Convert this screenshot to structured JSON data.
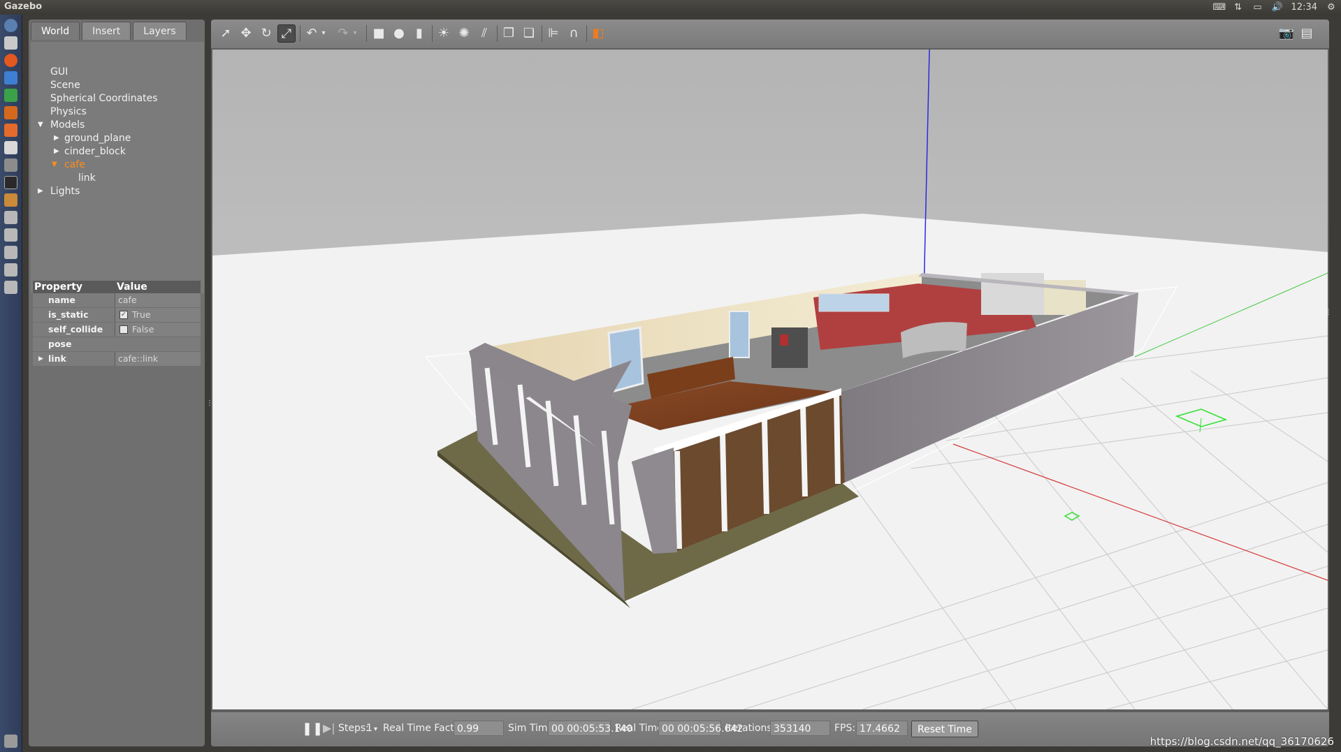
{
  "window": {
    "title": "Gazebo"
  },
  "tray": {
    "time": "12:34"
  },
  "left_panel": {
    "tabs": [
      {
        "label": "World",
        "active": true
      },
      {
        "label": "Insert"
      },
      {
        "label": "Layers"
      }
    ],
    "tree": {
      "gui": "GUI",
      "scene": "Scene",
      "spherical": "Spherical Coordinates",
      "physics": "Physics",
      "models": "Models",
      "ground_plane": "ground_plane",
      "cinder_block": "cinder_block",
      "cafe": "cafe",
      "link": "link",
      "lights": "Lights"
    },
    "properties": {
      "header_property": "Property",
      "header_value": "Value",
      "rows": [
        {
          "key": "name",
          "value": "cafe"
        },
        {
          "key": "is_static",
          "value": "True",
          "checked": true
        },
        {
          "key": "self_collide",
          "value": "False",
          "checked": false
        },
        {
          "key": "pose",
          "value": ""
        },
        {
          "key": "link",
          "value": "cafe::link"
        }
      ]
    }
  },
  "toolbar": {
    "icons": [
      "select-arrow-icon",
      "translate-icon",
      "rotate-icon",
      "scale-icon",
      "undo-icon",
      "undo-dropdown-icon",
      "redo-icon",
      "redo-dropdown-icon",
      "box-icon",
      "sphere-icon",
      "cylinder-icon",
      "point-light-icon",
      "spot-light-icon",
      "directional-light-icon",
      "copy-icon",
      "paste-icon",
      "align-icon",
      "snap-icon",
      "view-angle-icon",
      "screenshot-icon",
      "log-icon"
    ]
  },
  "bottom": {
    "steps_label": "Steps:",
    "steps_value": "1",
    "rtf_label": "Real Time Factor:",
    "rtf_value": "0.99",
    "sim_label": "Sim Time:",
    "sim_value": "00 00:05:53.140",
    "real_label": "Real Time:",
    "real_value": "00 00:05:56.642",
    "iter_label": "Iterations:",
    "iter_value": "353140",
    "fps_label": "FPS:",
    "fps_value": "17.4662",
    "reset_label": "Reset Time"
  },
  "watermark": "https://blog.csdn.net/qq_36170626",
  "colors": {
    "selected": "#ff8c1a",
    "accent_orange": "#f07b1e"
  }
}
